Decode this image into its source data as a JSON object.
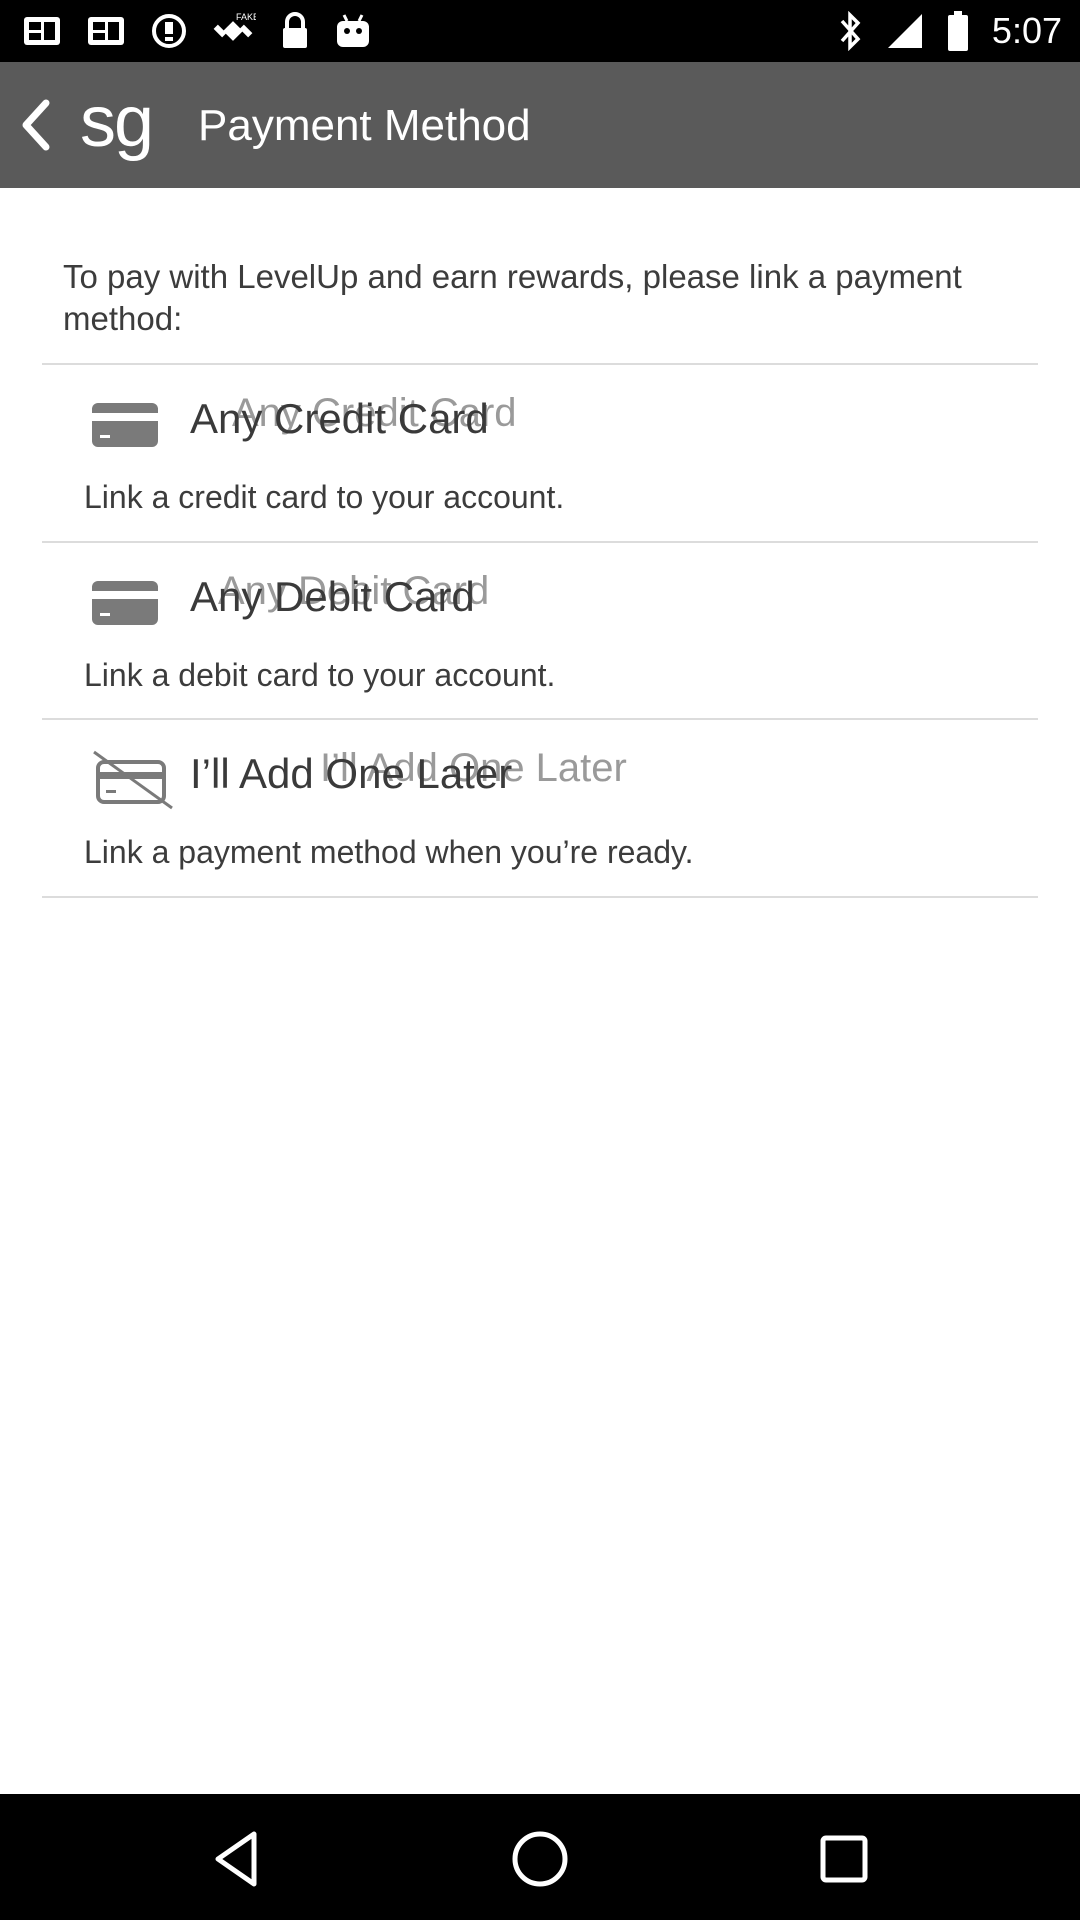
{
  "status_bar": {
    "time": "5:07",
    "icons": [
      "image-icon",
      "image-icon",
      "alert-circle-icon",
      "satellite-fake-gps-icon",
      "lock-icon",
      "android-icon",
      "bluetooth-icon",
      "signal-icon",
      "battery-icon"
    ]
  },
  "app_bar": {
    "back_icon": "chevron-left-icon",
    "logo_text": "sg",
    "title": "Payment Method"
  },
  "intro": "To pay with LevelUp and earn rewards, please link a payment method:",
  "options": [
    {
      "icon": "credit-card-icon",
      "title": "Any Credit Card",
      "ghost_title": "Any Credit Card",
      "description": "Link a credit card to your account."
    },
    {
      "icon": "debit-card-icon",
      "title": "Any Debit Card",
      "ghost_title": "Any Debit Card",
      "description": "Link a debit card to your account."
    },
    {
      "icon": "card-off-icon",
      "title": "I’ll Add One Later",
      "ghost_title": "I’ll Add One Later",
      "description": "Link a payment method when you’re ready."
    }
  ],
  "nav_bar": {
    "back": "triangle-back-icon",
    "home": "circle-home-icon",
    "recents": "square-recents-icon"
  },
  "colors": {
    "app_bar": "#5a5a5a",
    "status_bar": "#000000",
    "text": "#3c3c3c",
    "divider": "#dcdcdc",
    "icon": "#7a7a7a"
  }
}
